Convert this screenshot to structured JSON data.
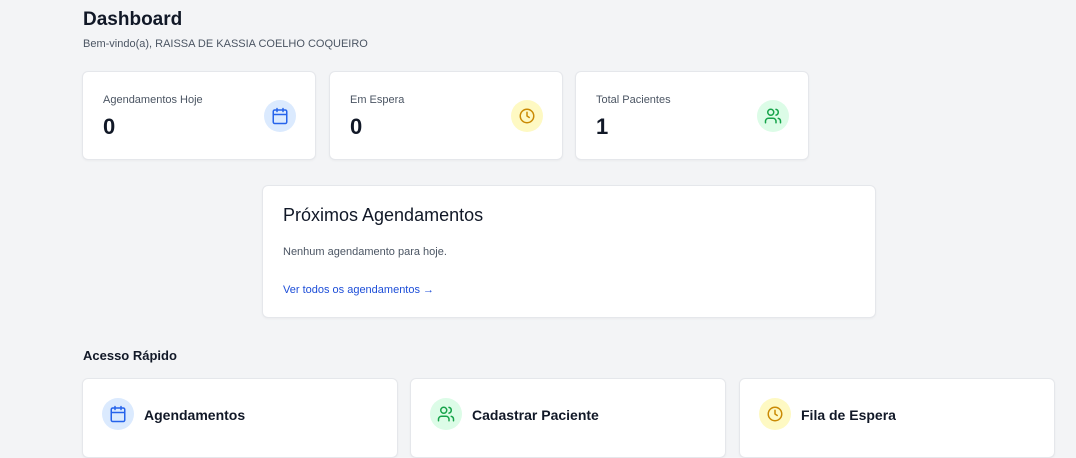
{
  "header": {
    "title": "Dashboard",
    "subtitle": "Bem-vindo(a), RAISSA DE KASSIA COELHO COQUEIRO"
  },
  "stats": [
    {
      "label": "Agendamentos Hoje",
      "value": "0",
      "icon": "calendar-icon",
      "icon_color": "#2563eb",
      "icon_bg": "#dbeafe"
    },
    {
      "label": "Em Espera",
      "value": "0",
      "icon": "clock-icon",
      "icon_color": "#ca8a04",
      "icon_bg": "#fef9c3"
    },
    {
      "label": "Total Pacientes",
      "value": "1",
      "icon": "users-icon",
      "icon_color": "#16a34a",
      "icon_bg": "#dcfce7"
    }
  ],
  "upcoming": {
    "title": "Próximos Agendamentos",
    "empty_text": "Nenhum agendamento para hoje.",
    "link_text": "Ver todos os agendamentos →"
  },
  "quick_access": {
    "title": "Acesso Rápido",
    "items": [
      {
        "label": "Agendamentos",
        "icon": "calendar-icon"
      },
      {
        "label": "Cadastrar Paciente",
        "icon": "users-icon"
      },
      {
        "label": "Fila de Espera",
        "icon": "clock-icon"
      }
    ]
  }
}
